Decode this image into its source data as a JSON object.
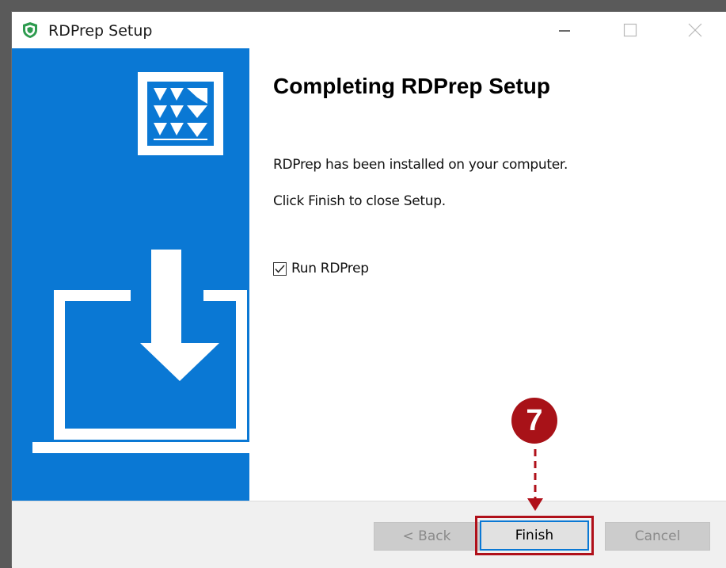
{
  "window": {
    "title": "RDPrep Setup"
  },
  "content": {
    "heading": "Completing RDPrep Setup",
    "message_installed": "RDPrep has been installed on your computer.",
    "message_finish": "Click Finish to close Setup.",
    "checkbox": {
      "label": "Run RDPrep",
      "checked": true
    }
  },
  "buttons": {
    "back": "< Back",
    "finish": "Finish",
    "cancel": "Cancel"
  },
  "annotation": {
    "step_number": "7"
  },
  "colors": {
    "sidebar_blue": "#0a78d4",
    "annotation_red": "#a81218"
  }
}
